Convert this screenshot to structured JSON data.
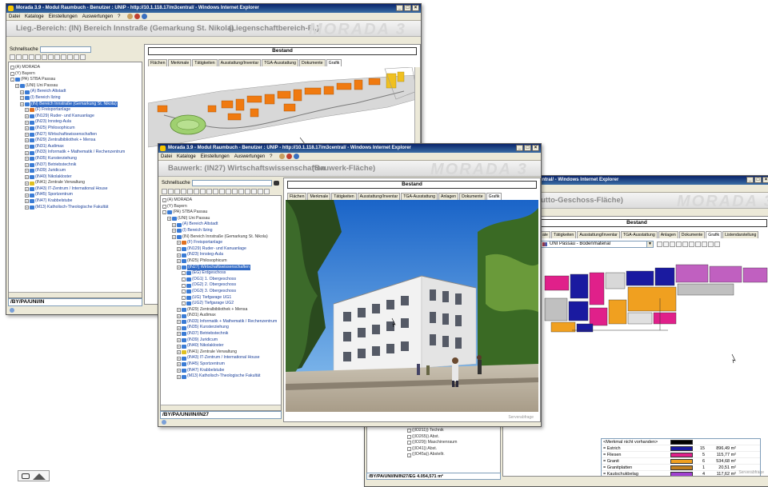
{
  "window_back": {
    "title": "Morada 3.9 - Modul Raumbuch - Benutzer : UNIP - http://10.1.118.17/m3central/ - Windows Internet Explorer",
    "menu": [
      "Datei",
      "Kataloge",
      "Einstellungen",
      "Auswertungen",
      "?"
    ],
    "header_text": "Lieg.-Bereich:  (IN)  Bereich Innstraße (Gemarkung St. Nikola)",
    "header_type": "(Liegenschaftbereich-Fl.)",
    "brand": "MORADA 3",
    "search_label": "Schnellsuche",
    "tree": [
      {
        "label": "(A) MORADA",
        "indent": 0,
        "link": false
      },
      {
        "label": "(Y) Bayern",
        "indent": 0,
        "link": false
      },
      {
        "label": "(PA) STBA Passau",
        "indent": 0,
        "link": false,
        "icon": "#3a7bd5"
      },
      {
        "label": "(UNI) Uni Passau",
        "indent": 1,
        "link": false,
        "icon": "#3a7bd5"
      },
      {
        "label": "(A) Bereich Altstadt",
        "indent": 2,
        "link": true,
        "icon": "#3a7bd5"
      },
      {
        "label": "(I) Bereich Ilzing",
        "indent": 2,
        "link": true,
        "icon": "#3a7bd5"
      },
      {
        "label": "(IN) Bereich Innstraße (Gemarkung St. Nikola)",
        "indent": 2,
        "link": false,
        "sel": true,
        "icon": "#3a7bd5"
      },
      {
        "label": "(F) Freisportanlage",
        "indent": 3,
        "link": true,
        "icon": "#e07020"
      },
      {
        "label": "(IN129) Ruder- und Kanuanlage",
        "indent": 3,
        "link": true,
        "icon": "#3a7bd5"
      },
      {
        "label": "(IN23) Innsteg-Aula",
        "indent": 3,
        "link": true,
        "icon": "#3a7bd5"
      },
      {
        "label": "(IN25) Philosophicum",
        "indent": 3,
        "link": true,
        "icon": "#3a7bd5"
      },
      {
        "label": "(IN27) Wirtschaftswissenschaften",
        "indent": 3,
        "link": true,
        "icon": "#3a7bd5"
      },
      {
        "label": "(IN29) Zentralbibliothek + Mensa",
        "indent": 3,
        "link": true,
        "icon": "#3a7bd5"
      },
      {
        "label": "(IN31) Audimax",
        "indent": 3,
        "link": true,
        "icon": "#3a7bd5"
      },
      {
        "label": "(IN33) Informatik + Mathematik / Rechenzentrum",
        "indent": 3,
        "link": true,
        "icon": "#3a7bd5"
      },
      {
        "label": "(IN35) Kunsterziehung",
        "indent": 3,
        "link": true,
        "icon": "#3a7bd5"
      },
      {
        "label": "(IN37) Betriebstechnik",
        "indent": 3,
        "link": true,
        "icon": "#3a7bd5"
      },
      {
        "label": "(IN39) Juridicum",
        "indent": 3,
        "link": true,
        "icon": "#3a7bd5"
      },
      {
        "label": "(IN40) Nikolakloster",
        "indent": 3,
        "link": true,
        "icon": "#3a7bd5"
      },
      {
        "label": "(IN41) Zentrale Verwaltung",
        "indent": 3,
        "link": false,
        "icon": "#e0c020"
      },
      {
        "label": "(IN43) IT-Zentrum / International House",
        "indent": 3,
        "link": true,
        "icon": "#3a7bd5"
      },
      {
        "label": "(IN45) Sportzentrum",
        "indent": 3,
        "link": true,
        "icon": "#3a7bd5"
      },
      {
        "label": "(IN47) Krabbelstube",
        "indent": 3,
        "link": true,
        "icon": "#3a7bd5"
      },
      {
        "label": "(M13) Katholisch-Theologische Fakultät",
        "indent": 3,
        "link": true,
        "icon": "#3a7bd5"
      }
    ],
    "path": "/BY/PA/UNI/IN",
    "bestand": "Bestand",
    "tabs": [
      "Flächen",
      "Merkmale",
      "Tätigkeiten",
      "Ausstattung/Inventar",
      "TGA-Ausstattung",
      "Dokumente",
      "Grafik"
    ]
  },
  "window_mid": {
    "title": "Morada 3.9 - Modul Raumbuch - Benutzer : UNIP - http://10.1.118.17/m3central/ - Windows Internet Explorer",
    "menu": [
      "Datei",
      "Kataloge",
      "Einstellungen",
      "Auswertungen",
      "?"
    ],
    "header_text": "Bauwerk:  (IN27)  Wirtschaftswissenschaften",
    "header_type": "(Bauwerk-Fläche)",
    "brand": "MORADA 3",
    "search_label": "Schnellsuche",
    "tree": [
      {
        "label": "(A) MORADA",
        "indent": 0,
        "link": false
      },
      {
        "label": "(Y) Bayern",
        "indent": 0,
        "link": false
      },
      {
        "label": "(PA) STBA Passau",
        "indent": 0,
        "link": false,
        "icon": "#3a7bd5"
      },
      {
        "label": "(UNI) Uni Passau",
        "indent": 1,
        "link": false,
        "icon": "#3a7bd5"
      },
      {
        "label": "(A) Bereich Altstadt",
        "indent": 2,
        "link": true,
        "icon": "#3a7bd5"
      },
      {
        "label": "(I) Bereich Ilzing",
        "indent": 2,
        "link": true,
        "icon": "#3a7bd5"
      },
      {
        "label": "(IN) Bereich Innstraße (Gemarkung St. Nikola)",
        "indent": 2,
        "link": false,
        "icon": "#3a7bd5"
      },
      {
        "label": "(F) Freisportanlage",
        "indent": 3,
        "link": true,
        "icon": "#e07020"
      },
      {
        "label": "(IN129) Ruder- und Kanuanlage",
        "indent": 3,
        "link": true,
        "icon": "#3a7bd5"
      },
      {
        "label": "(IN23) Innsteg-Aula",
        "indent": 3,
        "link": true,
        "icon": "#3a7bd5"
      },
      {
        "label": "(IN25) Philosophicum",
        "indent": 3,
        "link": false,
        "icon": "#3a7bd5"
      },
      {
        "label": "(IN27) Wirtschaftswissenschaften",
        "indent": 3,
        "link": false,
        "sel": true,
        "icon": "#3a7bd5"
      },
      {
        "label": "(EG) Erdgeschoss",
        "indent": 4,
        "link": true,
        "icon": "#3a7bd5"
      },
      {
        "label": "(OG1) 1. Obergeschoss",
        "indent": 4,
        "link": true,
        "icon": "#3a7bd5"
      },
      {
        "label": "(OG2) 2. Obergeschoss",
        "indent": 4,
        "link": true,
        "icon": "#3a7bd5"
      },
      {
        "label": "(OG3) 3. Obergeschoss",
        "indent": 4,
        "link": true,
        "icon": "#3a7bd5"
      },
      {
        "label": "(UG) Tiefgarage UG1",
        "indent": 4,
        "link": true,
        "icon": "#3a7bd5"
      },
      {
        "label": "(UG2) Tiefgarage UG2",
        "indent": 4,
        "link": true,
        "icon": "#3a7bd5"
      },
      {
        "label": "(IN29) Zentralbibliothek + Mensa",
        "indent": 3,
        "link": false,
        "icon": "#3a7bd5"
      },
      {
        "label": "(IN31) Audimax",
        "indent": 3,
        "link": false,
        "icon": "#3a7bd5"
      },
      {
        "label": "(IN33) Informatik + Mathematik / Rechenzentrum",
        "indent": 3,
        "link": true,
        "icon": "#3a7bd5"
      },
      {
        "label": "(IN35) Kunsterziehung",
        "indent": 3,
        "link": true,
        "icon": "#3a7bd5"
      },
      {
        "label": "(IN37) Betriebstechnik",
        "indent": 3,
        "link": true,
        "icon": "#3a7bd5"
      },
      {
        "label": "(IN39) Juridicum",
        "indent": 3,
        "link": true,
        "icon": "#3a7bd5"
      },
      {
        "label": "(IN40) Nikolakloster",
        "indent": 3,
        "link": true,
        "icon": "#3a7bd5"
      },
      {
        "label": "(IN41) Zentrale Verwaltung",
        "indent": 3,
        "link": false,
        "icon": "#e0c020"
      },
      {
        "label": "(IN43) IT-Zentrum / International House",
        "indent": 3,
        "link": true,
        "icon": "#3a7bd5"
      },
      {
        "label": "(IN45) Sportzentrum",
        "indent": 3,
        "link": true,
        "icon": "#3a7bd5"
      },
      {
        "label": "(IN47) Krabbelstube",
        "indent": 3,
        "link": true,
        "icon": "#3a7bd5"
      },
      {
        "label": "(M13) Katholisch-Theologische Fakultät",
        "indent": 3,
        "link": true,
        "icon": "#3a7bd5"
      }
    ],
    "path": "/BY/PA/UNI/IN/IN27",
    "bestand": "Bestand",
    "tabs": [
      "Flächen",
      "Merkmale",
      "Tätigkeiten",
      "Ausstattung/Inventar",
      "TGA-Ausstattung",
      "Anlagen",
      "Dokumente",
      "Grafik"
    ],
    "status_right": "Serverabfrage"
  },
  "window_front": {
    "title_fragment": "entral/ - Windows Internet Explorer",
    "header_type": "utto-Geschoss-Fläche)",
    "brand": "MORADA 3",
    "bestand": "Bestand",
    "tabs": [
      "ale",
      "Tätigkeiten",
      "Ausstattung/Inventar",
      "TGA-Ausstattung",
      "Anlagen",
      "Dokumente",
      "Grafik",
      "Listendarstellung"
    ],
    "dropdown_value": "UNI Passau - Bodenmaterial",
    "tree_fragment": [
      {
        "label": "((IO211)) Technik"
      },
      {
        "label": "((IO265)) Abst."
      },
      {
        "label": "((IO29)) Maschinenraum"
      },
      {
        "label": "((IO41)) Abst."
      },
      {
        "label": "((IO45a)) Abstellr."
      }
    ],
    "path": "/BY/PA/UNI/IN/IN27/EG 4.054,571 m²",
    "legend": [
      {
        "name": "<Merkmal nicht vorhanden>",
        "color": "#000000",
        "count": "",
        "area": ""
      },
      {
        "name": "= Estrich",
        "color": "#1a1aa0",
        "count": "15",
        "area": "896,49 m²"
      },
      {
        "name": "= Fliesen",
        "color": "#e0208a",
        "count": "5",
        "area": "115,77 m²"
      },
      {
        "name": "= Granit",
        "color": "#f0a020",
        "count": "6",
        "area": "534,68 m²"
      },
      {
        "name": "= Granitplatten",
        "color": "#c08020",
        "count": "1",
        "area": "20,51 m²"
      },
      {
        "name": "= Kautschukbelag",
        "color": "#a040d0",
        "count": "4",
        "area": "117,62 m²"
      }
    ],
    "status_right": "Serverabfrage"
  },
  "colors": {
    "titlebar": "#0a246a",
    "selection": "#316ac5",
    "link": "#1a3f99",
    "orange_building": "#f07a10"
  }
}
